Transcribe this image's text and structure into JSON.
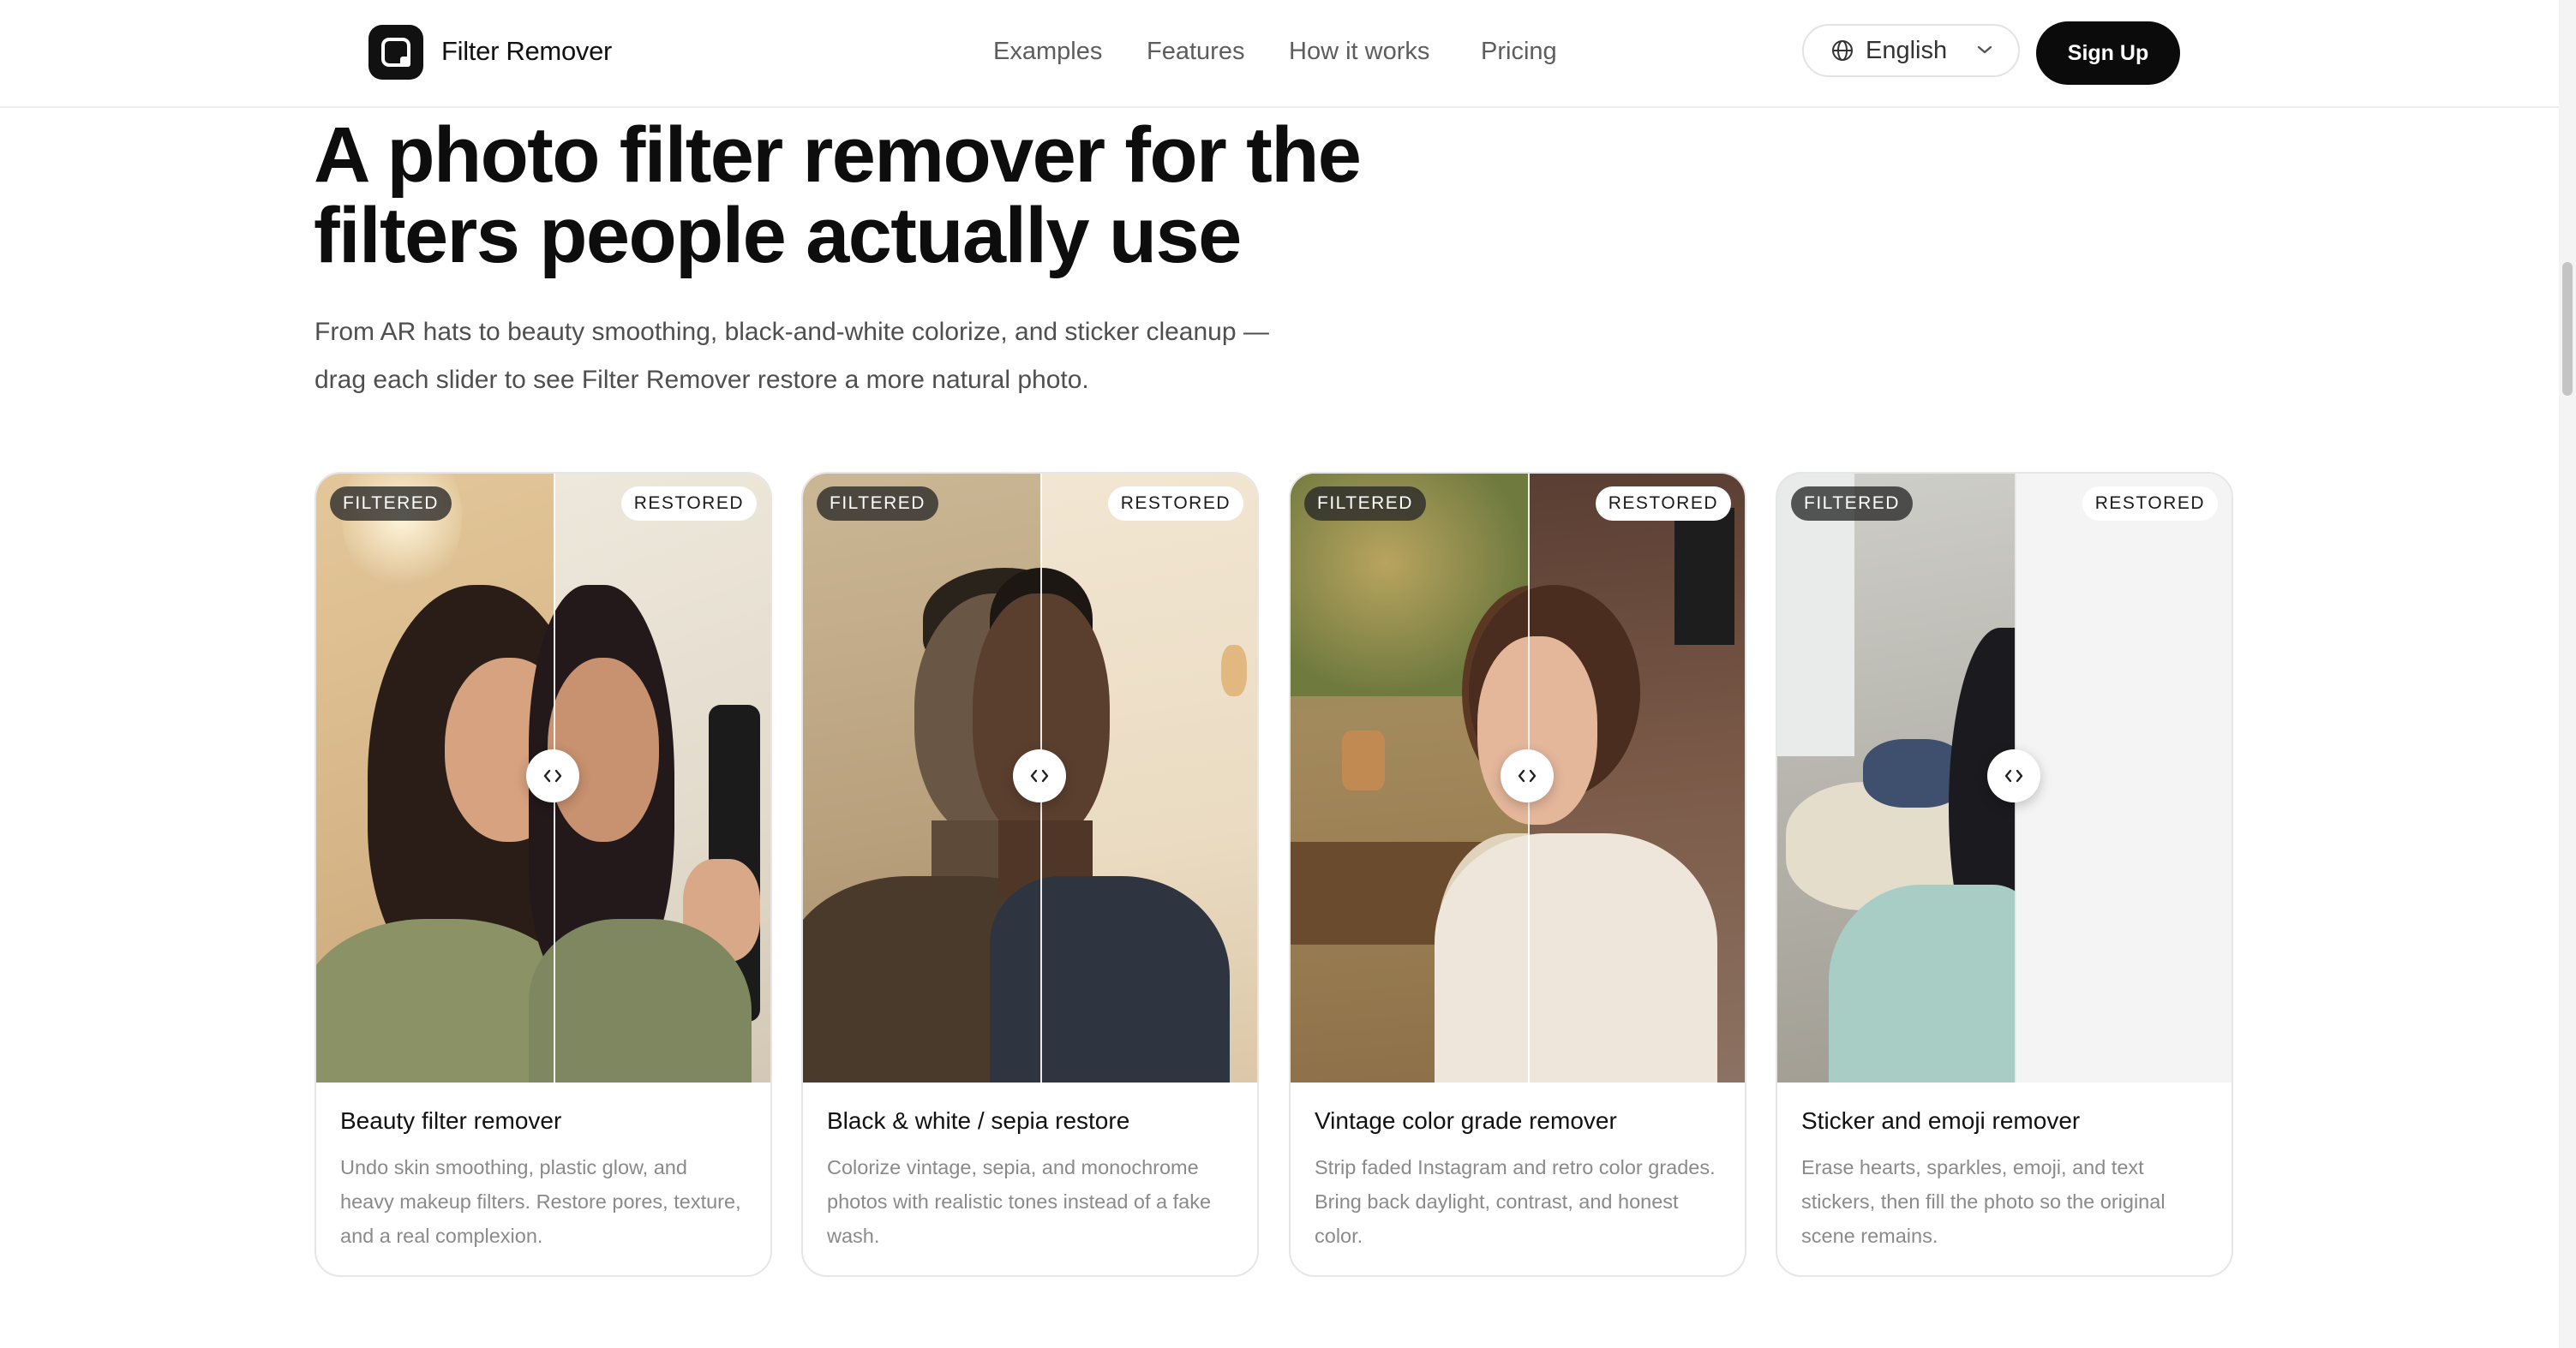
{
  "header": {
    "brand": "Filter Remover",
    "nav": [
      "Examples",
      "Features",
      "How it works",
      "Pricing"
    ],
    "language": "English",
    "signup": "Sign Up"
  },
  "hero": {
    "title_line1": "A photo filter remover for the",
    "title_line2": "filters people actually use",
    "subtitle_line1": "From AR hats to beauty smoothing, black-and-white colorize, and sticker cleanup —",
    "subtitle_line2": "drag each slider to see Filter Remover restore a more natural photo."
  },
  "cards": [
    {
      "before_label": "FILTERED",
      "after_label": "RESTORED",
      "title": "Beauty filter remover",
      "description": "Undo skin smoothing, plastic glow, and heavy makeup filters. Restore pores, texture, and a real complexion."
    },
    {
      "before_label": "FILTERED",
      "after_label": "RESTORED",
      "title": "Black & white / sepia restore",
      "description": "Colorize vintage, sepia, and monochrome photos with realistic tones instead of a fake wash."
    },
    {
      "before_label": "FILTERED",
      "after_label": "RESTORED",
      "title": "Vintage color grade remover",
      "description": "Strip faded Instagram and retro color grades. Bring back daylight, contrast, and honest color."
    },
    {
      "before_label": "FILTERED",
      "after_label": "RESTORED",
      "title": "Sticker and emoji remover",
      "description": "Erase hearts, sparkles, emoji, and text stickers, then fill the photo so the original scene remains."
    }
  ],
  "slider_position": 0.52,
  "colors": {
    "accent": "#0b0b0b",
    "badge_filtered": "#2f2f2f",
    "badge_restored": "#ffffff",
    "muted_text": "#8a8a8a"
  },
  "icons": [
    "logo-icon",
    "globe-icon",
    "chevron-down-icon",
    "slider-arrows-icon"
  ]
}
